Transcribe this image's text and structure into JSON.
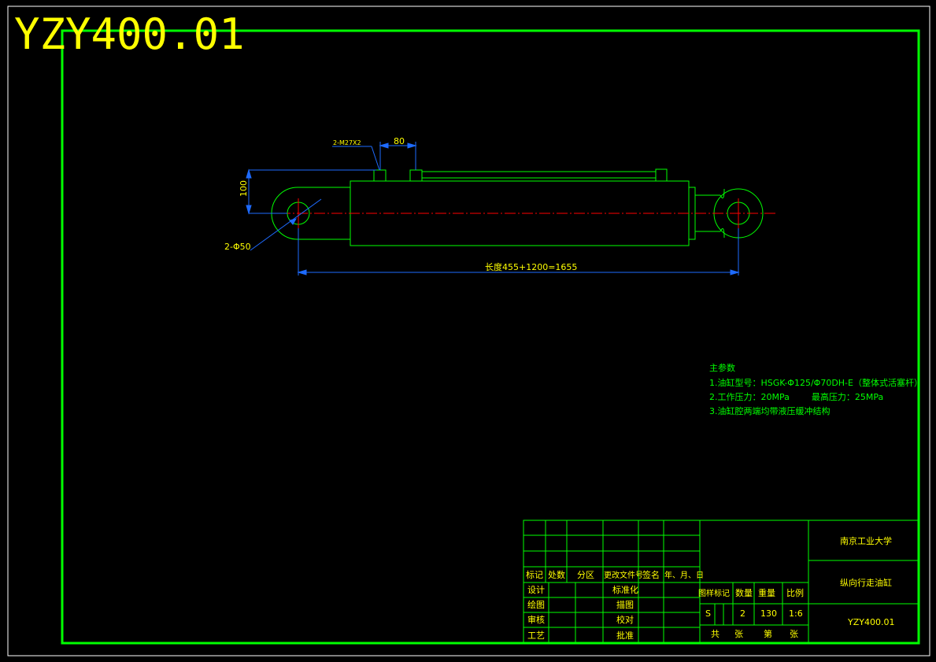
{
  "drawing_number": "YZY400.01",
  "colors": {
    "background": "#000000",
    "frame": "#00ff00",
    "outline": "#00ff00",
    "centerline": "#ff0000",
    "dimension": "#1e6bff",
    "text": "#ffff00",
    "notes": "#00ff00",
    "border": "#ffffff"
  },
  "dimensions": {
    "thread": "2-M27X2",
    "port_spacing": "80",
    "height": "100",
    "pin_hole": "2-Φ50",
    "length": "长度455+1200=1655"
  },
  "notes": {
    "title": "主参数",
    "lines": [
      "1.油缸型号：HSGK-Φ125/Φ70DH-E（整体式活塞杆）",
      "2.工作压力：20MPa        最高压力：25MPa",
      "3.油缸腔两端均带液压缓冲结构"
    ]
  },
  "title_block": {
    "revision_headers": [
      "标记",
      "处数",
      "分区",
      "更改文件号",
      "签名",
      "年、月、日"
    ],
    "role_left": [
      "设计",
      "绘图",
      "审核",
      "工艺"
    ],
    "role_right": [
      "标准化",
      "描图",
      "校对",
      "批准"
    ],
    "props_headers": [
      "图样标记",
      "数量",
      "重量",
      "比例"
    ],
    "props_values": [
      "S",
      "2",
      "130",
      "1:6"
    ],
    "sheet_total": "共",
    "sheet_unit1": "张",
    "sheet_no": "第",
    "sheet_unit2": "张",
    "company": "南京工业大学",
    "part_name": "纵向行走油缸",
    "drawing_code": "YZY400.01"
  }
}
